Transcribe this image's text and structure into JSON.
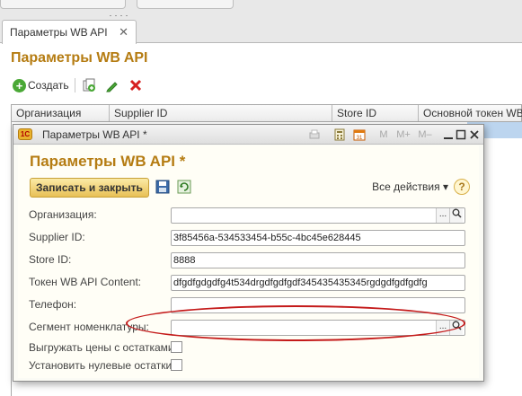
{
  "tab": {
    "label": "Параметры WB API",
    "close": "✕"
  },
  "page": {
    "title": "Параметры WB API"
  },
  "toolbar": {
    "create_label": "Создать"
  },
  "list": {
    "columns": [
      "Организация",
      "Supplier ID",
      "Store ID",
      "Основной токен WB A"
    ]
  },
  "modal": {
    "window_title": "Параметры WB API *",
    "app_icon_text": "1С",
    "title_buttons": {
      "m": "M",
      "m_plus": "M+",
      "m_minus": "M–"
    },
    "form_title": "Параметры WB API *",
    "save_close_label": "Записать и закрыть",
    "all_actions_label": "Все действия ▾",
    "help_label": "?",
    "fields": {
      "org": {
        "label": "Организация:",
        "value": ""
      },
      "supplier": {
        "label": "Supplier ID:",
        "value": "3f85456a-534533454-b55c-4bc45e628445"
      },
      "store": {
        "label": "Store ID:",
        "value": "8888"
      },
      "token": {
        "label": "Токен WB API Content:",
        "value": "dfgdfgdgdfg4t534drgdfgdfgdf345435435345rgdgdfgdfgdfg"
      },
      "phone": {
        "label": "Телефон:",
        "value": ""
      },
      "segment": {
        "label": "Сегмент номенклатуры:",
        "value": ""
      },
      "upload_prices": {
        "label": "Выгружать цены с остатками:"
      },
      "zero_stock": {
        "label": "Установить нулевые остатки:"
      }
    },
    "buttons": {
      "ellipsis": "...",
      "search": "Q"
    }
  }
}
